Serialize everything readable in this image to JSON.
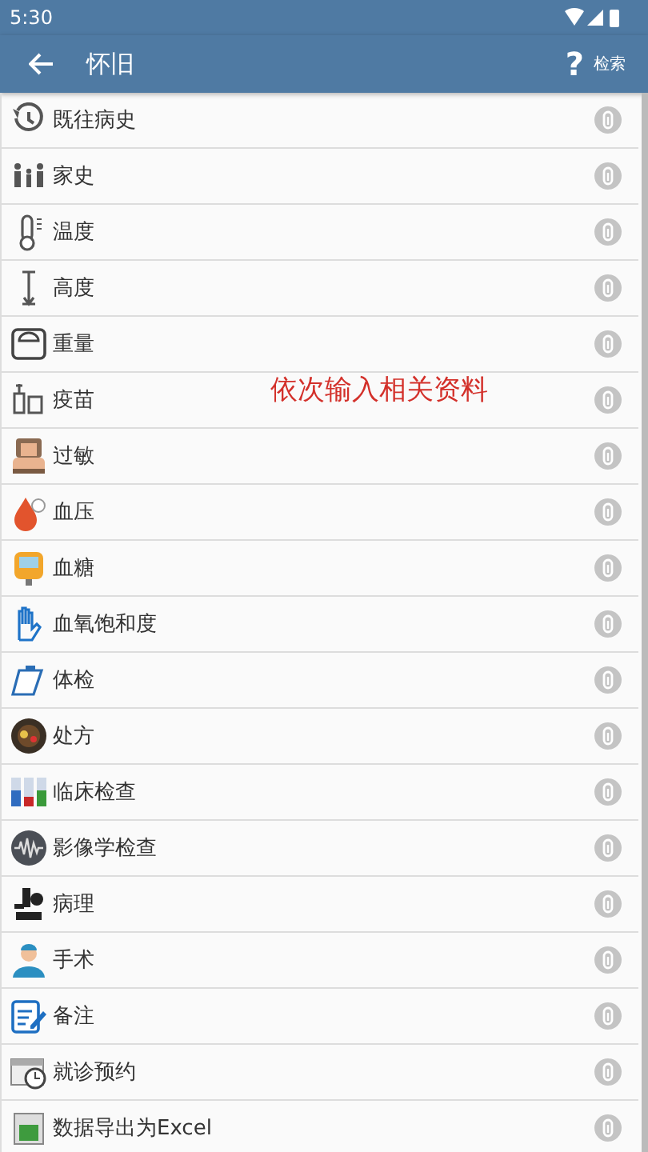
{
  "status_bar": {
    "time": "5:30"
  },
  "app_bar": {
    "title": "怀旧",
    "help": "?",
    "search": "检索"
  },
  "items": [
    {
      "label": "既往病史"
    },
    {
      "label": "家史"
    },
    {
      "label": "温度"
    },
    {
      "label": "高度"
    },
    {
      "label": "重量"
    },
    {
      "label": "疫苗"
    },
    {
      "label": "过敏"
    },
    {
      "label": "血压"
    },
    {
      "label": "血糖"
    },
    {
      "label": "血氧饱和度"
    },
    {
      "label": "体检"
    },
    {
      "label": "处方"
    },
    {
      "label": "临床检查"
    },
    {
      "label": "影像学检查"
    },
    {
      "label": "病理"
    },
    {
      "label": "手术"
    },
    {
      "label": "备注"
    },
    {
      "label": "就诊预约"
    },
    {
      "label": "数据导出为Excel"
    }
  ],
  "annotation": "依次输入相关资料"
}
